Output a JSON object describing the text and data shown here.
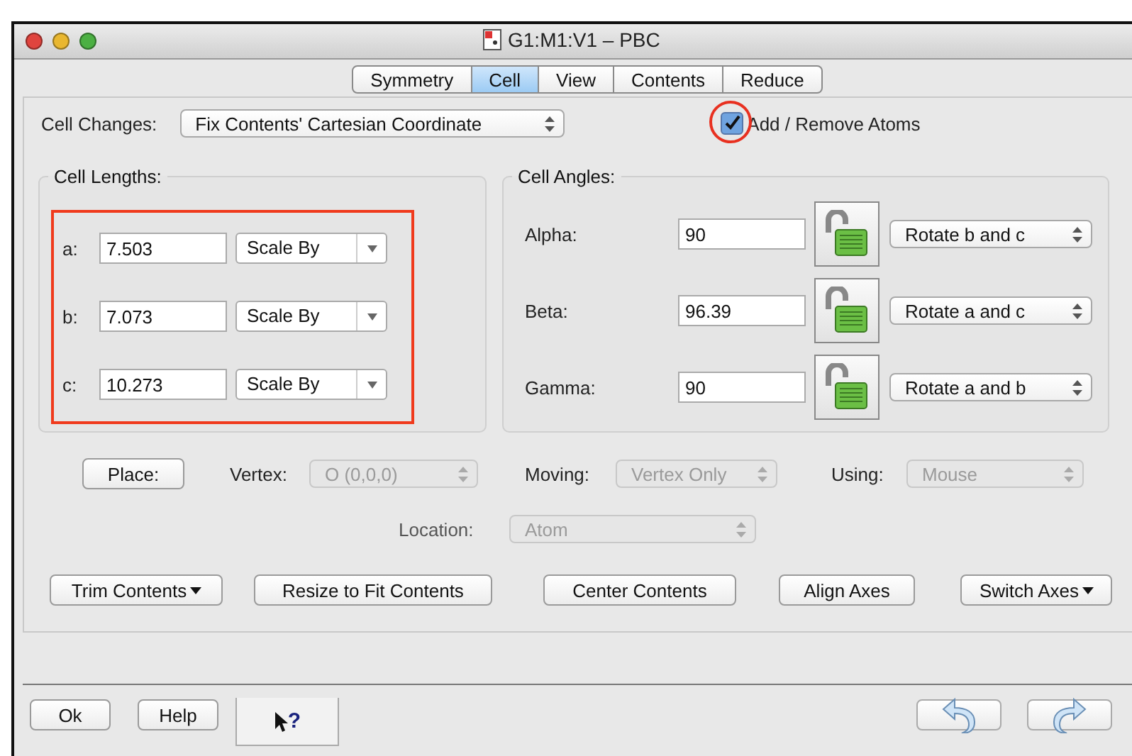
{
  "window": {
    "title": "G1:M1:V1 – PBC"
  },
  "tabs": [
    {
      "label": "Symmetry",
      "selected": false
    },
    {
      "label": "Cell",
      "selected": true
    },
    {
      "label": "View",
      "selected": false
    },
    {
      "label": "Contents",
      "selected": false
    },
    {
      "label": "Reduce",
      "selected": false
    }
  ],
  "cell_changes": {
    "label": "Cell Changes:",
    "value": "Fix Contents' Cartesian Coordinate"
  },
  "add_remove_atoms": {
    "label": "Add / Remove Atoms",
    "checked": true,
    "highlighted": true
  },
  "cell_lengths": {
    "title": "Cell Lengths:",
    "highlighted": true,
    "rows": [
      {
        "label": "a:",
        "value": "7.503",
        "mode": "Scale By"
      },
      {
        "label": "b:",
        "value": "7.073",
        "mode": "Scale By"
      },
      {
        "label": "c:",
        "value": "10.273",
        "mode": "Scale By"
      }
    ]
  },
  "cell_angles": {
    "title": "Cell Angles:",
    "rows": [
      {
        "label": "Alpha:",
        "value": "90",
        "locked": false,
        "rotate": "Rotate b and c"
      },
      {
        "label": "Beta:",
        "value": "96.39",
        "locked": false,
        "rotate": "Rotate a and c"
      },
      {
        "label": "Gamma:",
        "value": "90",
        "locked": false,
        "rotate": "Rotate a and b"
      }
    ]
  },
  "place": {
    "button": "Place:",
    "vertex": {
      "label": "Vertex:",
      "value": "O (0,0,0)",
      "disabled": true
    },
    "moving": {
      "label": "Moving:",
      "value": "Vertex Only",
      "disabled": true
    },
    "using": {
      "label": "Using:",
      "value": "Mouse",
      "disabled": true
    },
    "location": {
      "label": "Location:",
      "value": "Atom",
      "disabled": true
    }
  },
  "actions": [
    {
      "label": "Trim Contents",
      "has_menu": true
    },
    {
      "label": "Resize to Fit Contents",
      "has_menu": false
    },
    {
      "label": "Center Contents",
      "has_menu": false
    },
    {
      "label": "Align Axes",
      "has_menu": false
    },
    {
      "label": "Switch Axes",
      "has_menu": true
    }
  ],
  "footer": {
    "ok": "Ok",
    "help": "Help",
    "context_help": "?"
  }
}
